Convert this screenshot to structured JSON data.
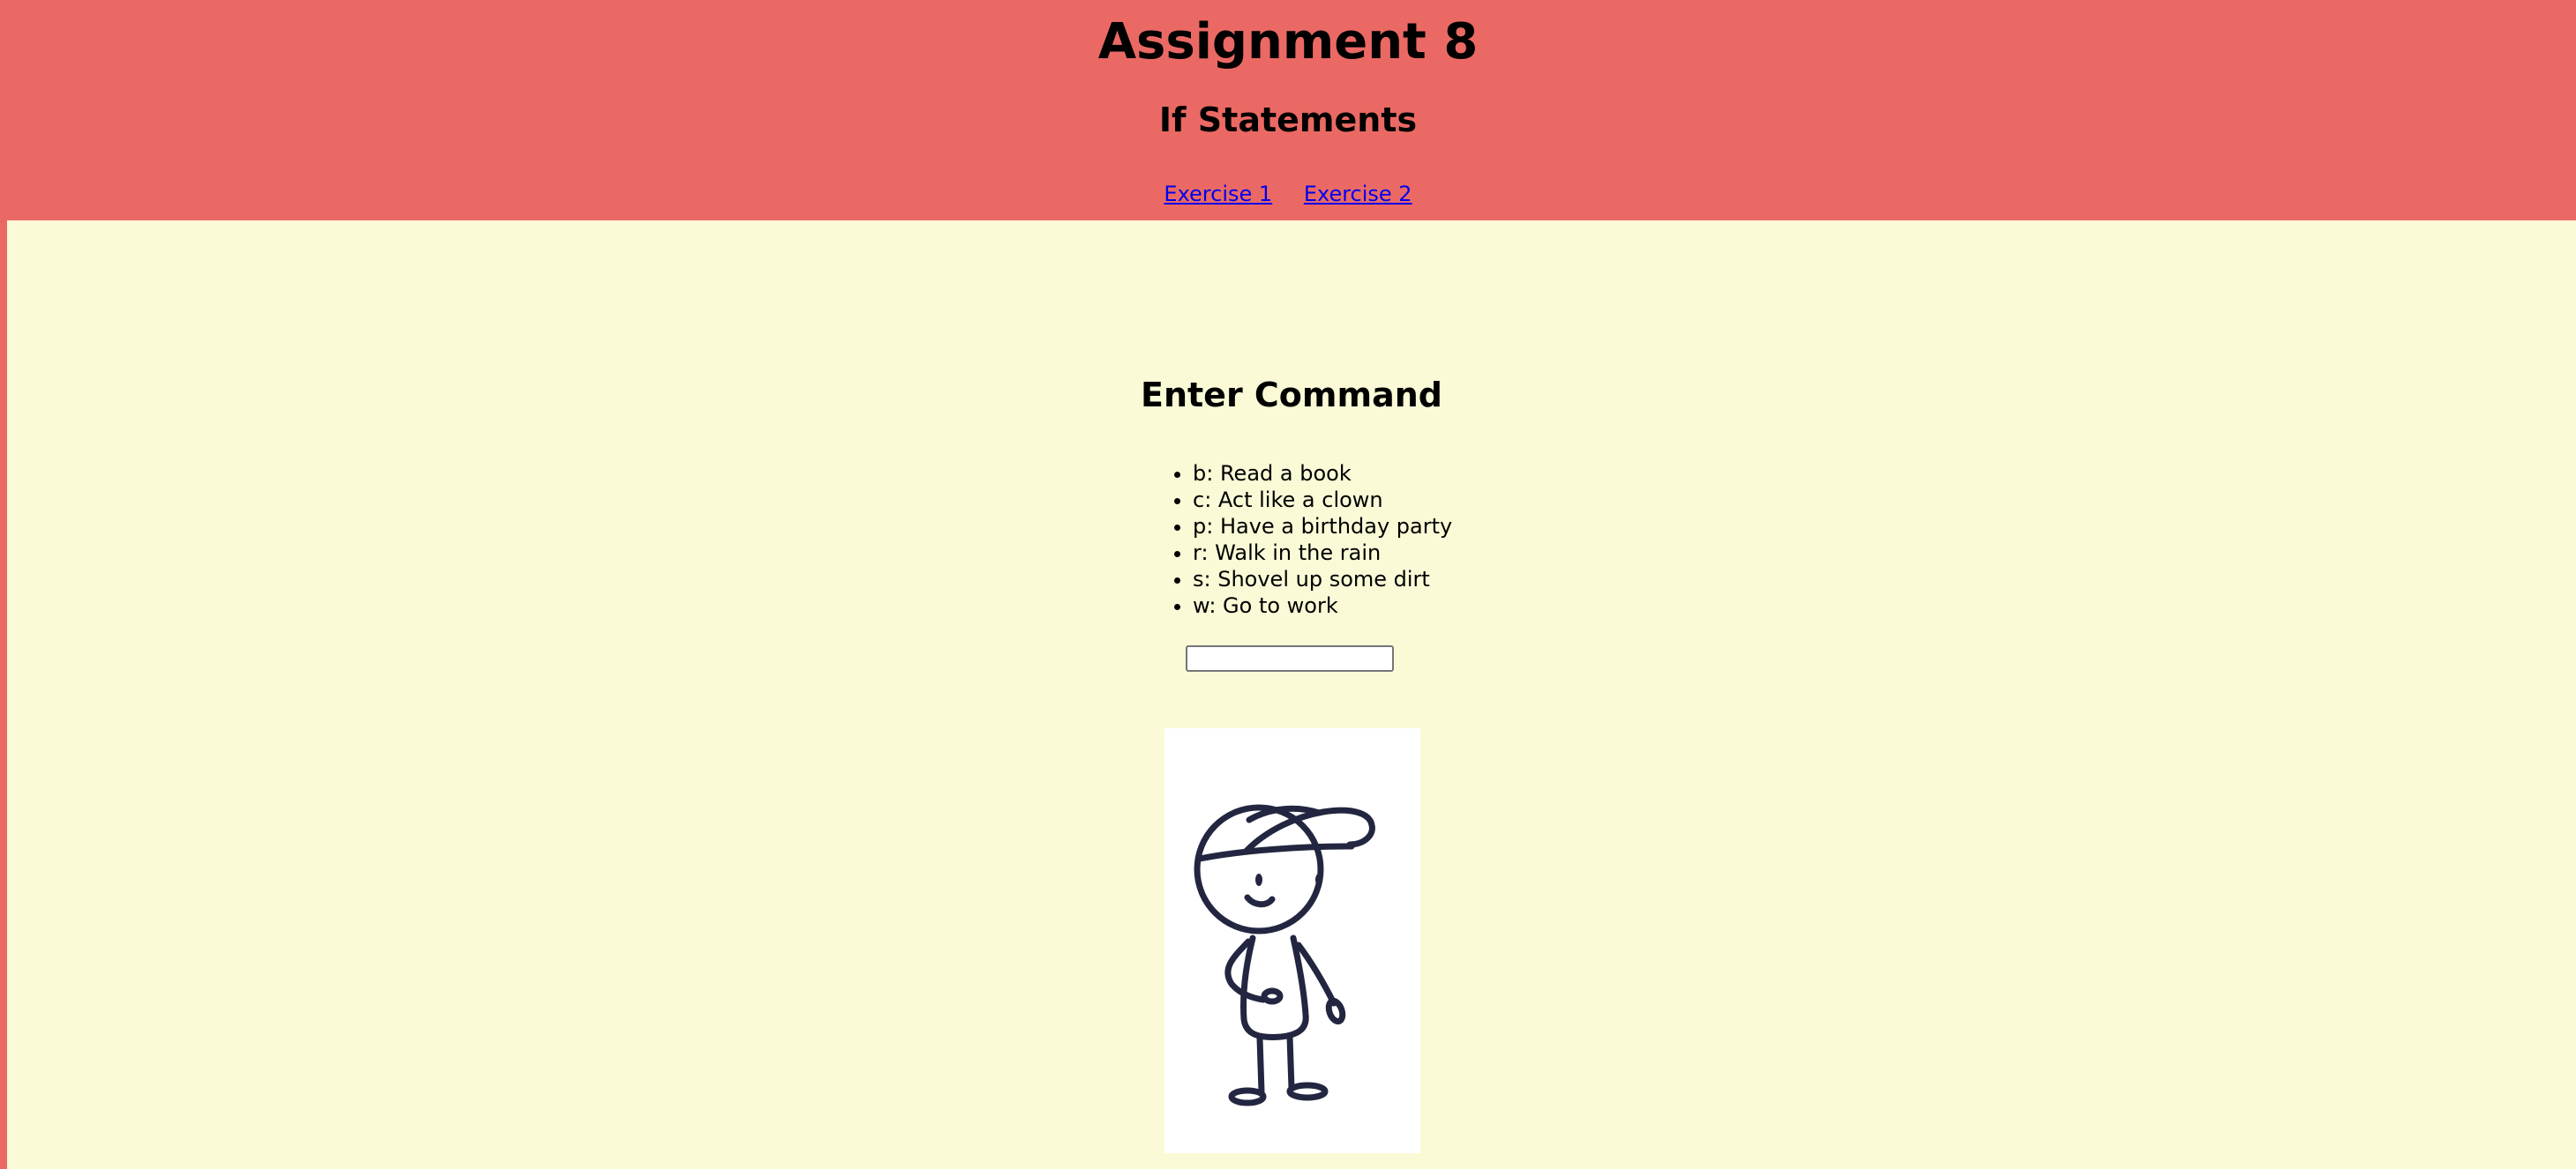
{
  "header": {
    "title": "Assignment 8",
    "subtitle": "If Statements",
    "nav": [
      {
        "label": "Exercise 1"
      },
      {
        "label": "Exercise 2"
      }
    ]
  },
  "main": {
    "heading": "Enter Command",
    "commands": [
      "b: Read a book",
      "c: Act like a clown",
      "p: Have a birthday party",
      "r: Walk in the rain",
      "s: Shovel up some dirt",
      "w: Go to work"
    ],
    "input_value": "",
    "image": {
      "icon": "stick-figure-boy-with-cap"
    }
  },
  "colors": {
    "header_bg": "#eb6964",
    "content_bg": "#fafad7",
    "link": "#0000ee",
    "drawing_stroke": "#232640"
  }
}
